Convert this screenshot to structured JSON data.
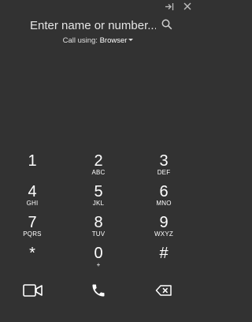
{
  "window": {
    "popout_icon": "popout-icon",
    "close_icon": "close-icon"
  },
  "search": {
    "placeholder": "Enter name or number...",
    "icon": "search-icon"
  },
  "call_using": {
    "label": "Call using:",
    "provider": "Browser"
  },
  "keypad": [
    {
      "digit": "1",
      "letters": ""
    },
    {
      "digit": "2",
      "letters": "ABC"
    },
    {
      "digit": "3",
      "letters": "DEF"
    },
    {
      "digit": "4",
      "letters": "GHI"
    },
    {
      "digit": "5",
      "letters": "JKL"
    },
    {
      "digit": "6",
      "letters": "MNO"
    },
    {
      "digit": "7",
      "letters": "PQRS"
    },
    {
      "digit": "8",
      "letters": "TUV"
    },
    {
      "digit": "9",
      "letters": "WXYZ"
    },
    {
      "digit": "*",
      "letters": ""
    },
    {
      "digit": "0",
      "letters": "+"
    },
    {
      "digit": "#",
      "letters": ""
    }
  ],
  "actions": {
    "video_icon": "video-camera-icon",
    "call_icon": "phone-icon",
    "backspace_icon": "backspace-icon"
  },
  "colors": {
    "background": "#323232",
    "text": "#ffffff",
    "muted": "#bdbdbd"
  }
}
